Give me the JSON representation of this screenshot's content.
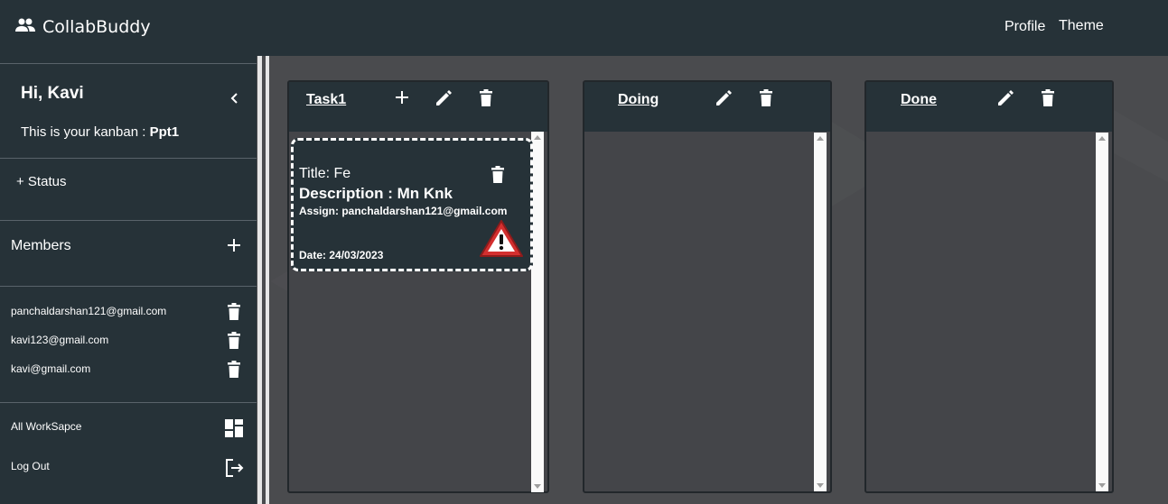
{
  "header": {
    "brand": "CollabBuddy",
    "nav": [
      "Profile",
      "Theme"
    ]
  },
  "sidebar": {
    "greeting": "Hi, Kavi",
    "kanban_prefix": "This is your kanban : ",
    "kanban_name": "Ppt1",
    "add_status": "+ Status",
    "members_label": "Members",
    "members": [
      "panchaldarshan121@gmail.com",
      "kavi123@gmail.com",
      "kavi@gmail.com"
    ],
    "all_workspace": "All WorkSapce",
    "logout": "Log Out"
  },
  "board": {
    "columns": [
      {
        "title": "Task1",
        "cards": [
          {
            "title_label": "Title:  Fe",
            "description": "Description : Mn Knk",
            "assign": "Assign: panchaldarshan121@gmail.com",
            "date": "Date: 24/03/2023"
          }
        ]
      },
      {
        "title": "Doing",
        "cards": []
      },
      {
        "title": "Done",
        "cards": []
      }
    ]
  },
  "colors": {
    "topbar": "#263238",
    "sidebar": "#263238",
    "board_bg": "#4a4b4e",
    "column_bg": "#444549",
    "warning": "#d32f2f"
  },
  "icons": {
    "brand": "group-icon",
    "collapse": "chevron-left-icon",
    "add": "plus-icon",
    "edit": "pencil-icon",
    "delete": "trash-icon",
    "workspace": "dashboard-icon",
    "logout": "logout-icon",
    "warning": "warning-icon"
  }
}
